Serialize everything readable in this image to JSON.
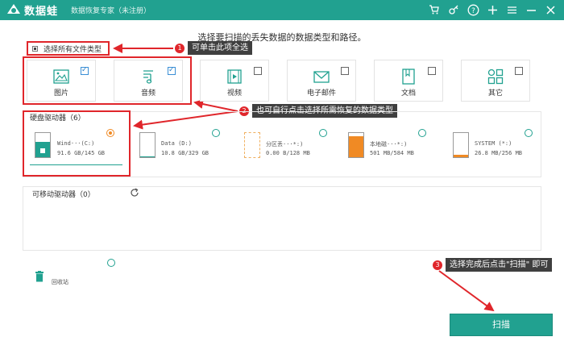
{
  "app": {
    "brand": "数据蛙",
    "subtitle": "数据恢复专家（未注册）"
  },
  "titlebar_icons": [
    "cart-icon",
    "key-icon",
    "help-icon",
    "plus-icon",
    "menu-icon",
    "minimize-icon",
    "close-icon"
  ],
  "prompt": "选择要扫描的丢失数据的数据类型和路径。",
  "select_all": {
    "label": "选择所有文件类型",
    "checked": true
  },
  "callouts": [
    {
      "num": "1",
      "text": "可单击此项全选"
    },
    {
      "num": "2",
      "text": "也可自行点击选择所需恢复的数据类型"
    },
    {
      "num": "3",
      "text": "选择完成后点击\"扫描\" 即可"
    }
  ],
  "file_types": [
    {
      "label": "图片",
      "icon": "image-icon",
      "checked": true
    },
    {
      "label": "音频",
      "icon": "audio-icon",
      "checked": true
    },
    {
      "label": "视频",
      "icon": "video-icon",
      "checked": false
    },
    {
      "label": "电子邮件",
      "icon": "email-icon",
      "checked": false
    },
    {
      "label": "文档",
      "icon": "document-icon",
      "checked": false
    },
    {
      "label": "其它",
      "icon": "other-icon",
      "checked": false
    }
  ],
  "hard_drives": {
    "title": "硬盘驱动器（6）",
    "items": [
      {
        "name": "Wind···(C:)",
        "size": "91.6 GB/145 GB",
        "selected": true,
        "used": 0.63
      },
      {
        "name": "Data (D:)",
        "size": "10.8 GB/329 GB",
        "selected": false,
        "used": 0.03
      },
      {
        "name": "分区丢···*:)",
        "size": "0.00 B/128 MB",
        "selected": false,
        "used": 0.0
      },
      {
        "name": "本地磁···*:)",
        "size": "501 MB/584 MB",
        "selected": false,
        "used": 0.86
      },
      {
        "name": "SYSTEM (*:)",
        "size": "26.8 MB/256 MB",
        "selected": false,
        "used": 0.1
      }
    ]
  },
  "removable": {
    "title": "可移动驱动器（0）"
  },
  "recycle_bin": {
    "label": "回收站",
    "selected": false
  },
  "scan_button": {
    "label": "扫描"
  },
  "colors": {
    "accent": "#21a190",
    "highlight": "#e0262b",
    "drive_fill": "#f08a24",
    "tooltip_bg": "#3f3f3f"
  }
}
